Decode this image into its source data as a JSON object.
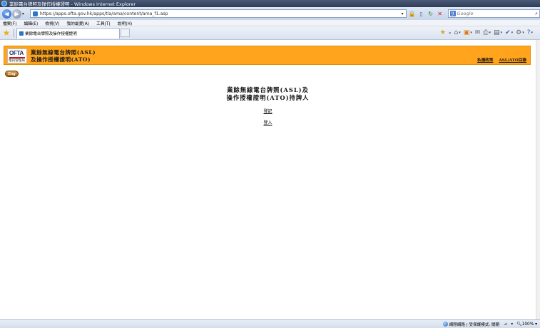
{
  "window": {
    "title": "業餘電台牌照及操作授權證明 - Windows Internet Explorer"
  },
  "address": {
    "url": "https://apps.ofta.gov.hk/apps/tla/ama/content/ama_f1.asp"
  },
  "search": {
    "placeholder": "Google"
  },
  "menu": {
    "items": [
      "檔案(F)",
      "編輯(E)",
      "檢視(V)",
      "我的最愛(A)",
      "工具(T)",
      "說明(H)"
    ]
  },
  "tab": {
    "label": "業餘電台牌照及操作授權證明"
  },
  "page": {
    "logo_text": "OFTA",
    "logo_sub": "電訊管理局",
    "banner_title_line1": "業餘無線電台牌照(ASL)",
    "banner_title_line2": "及操作授權證明(ATO)",
    "banner_links": [
      "私隱政策",
      "ASL/ATO目錄"
    ],
    "eng_button": "Eng",
    "heading_line1": "業餘無線電台牌照(ASL)及",
    "heading_line2": "操作授權證明(ATO)持牌人",
    "register_link": "登記",
    "login_link": "登入"
  },
  "status": {
    "zone": "網際網路 | 受保護模式: 關閉",
    "zoom": "100%"
  },
  "colors": {
    "banner": "#ffa41c",
    "titlebar": "#3a4866"
  }
}
